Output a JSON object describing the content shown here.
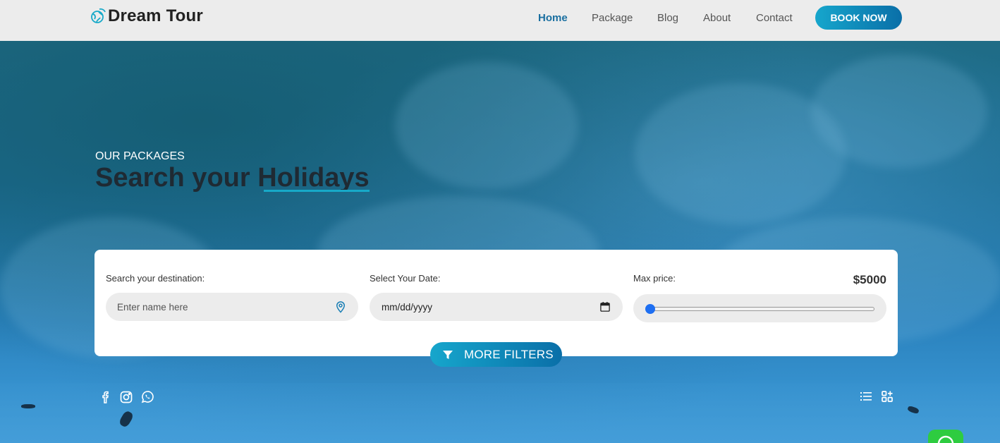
{
  "brand": {
    "name": "Dream Tour",
    "icon": "globe-icon",
    "accent": "#17a9c8"
  },
  "nav": {
    "items": [
      {
        "label": "Home",
        "active": true
      },
      {
        "label": "Package",
        "active": false
      },
      {
        "label": "Blog",
        "active": false
      },
      {
        "label": "About",
        "active": false
      },
      {
        "label": "Contact",
        "active": false
      }
    ],
    "cta": "BOOK NOW"
  },
  "hero": {
    "kicker": "OUR PACKAGES",
    "headline_prefix": "Search your ",
    "headline_accent": "Holidays"
  },
  "search": {
    "destination_label": "Search your destination:",
    "destination_placeholder": "Enter name here",
    "destination_icon": "map-pin-icon",
    "date_label": "Select Your Date:",
    "date_value": "mm/dd/yyyy",
    "date_icon": "calendar-icon",
    "price_label": "Max price:",
    "price_value": "$5000",
    "price_slider_fraction": 0.0
  },
  "more_filters": {
    "label": "MORE FILTERS",
    "icon": "filter-icon"
  },
  "social": [
    "facebook-icon",
    "instagram-icon",
    "whatsapp-icon"
  ],
  "view_toggles": [
    "list-view-icon",
    "grid-view-icon"
  ],
  "chat_widget": {
    "icon": "whatsapp-chat-icon",
    "color": "#2ecc40"
  }
}
